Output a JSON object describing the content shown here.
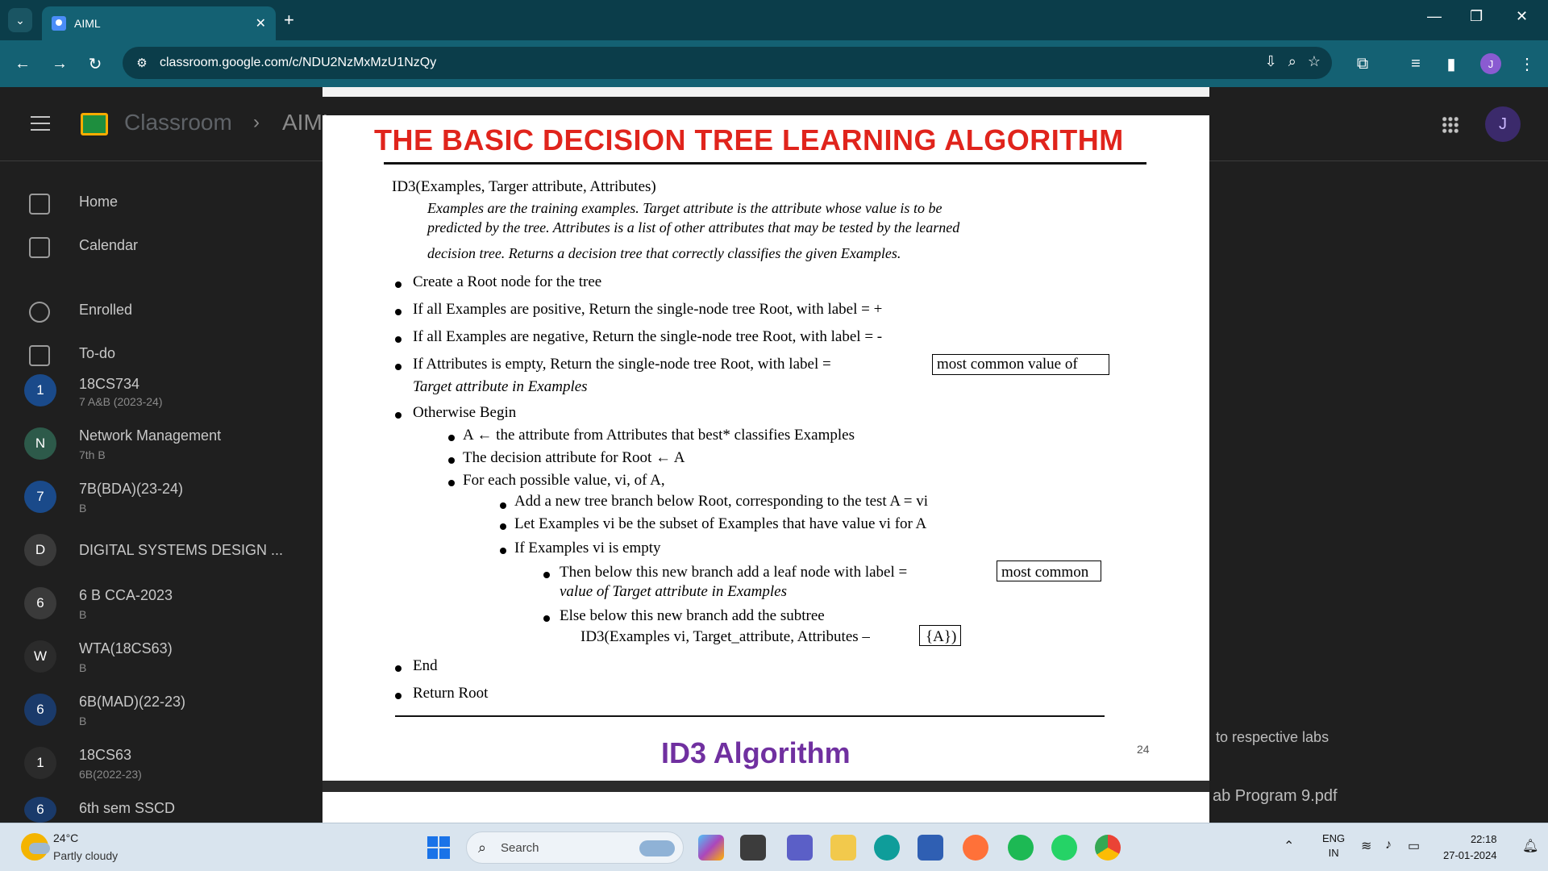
{
  "browser": {
    "tab_title": "AIML",
    "url": "classroom.google.com/c/NDU2NzMxMzU1NzQy",
    "avatar_letter": "J"
  },
  "classroom": {
    "app_name": "Classroom",
    "crumb": "AIML",
    "avatar_letter": "J",
    "nav": [
      {
        "label": "Home"
      },
      {
        "label": "Calendar"
      },
      {
        "label": "Enrolled"
      },
      {
        "label": "To-do"
      }
    ],
    "courses": [
      {
        "letter": "1",
        "name": "18CS734",
        "sub": "7 A&B (2023-24)",
        "color": "#1a4a8a"
      },
      {
        "letter": "N",
        "name": "Network Management",
        "sub": "7th B",
        "color": "#2d5a4a"
      },
      {
        "letter": "7",
        "name": "7B(BDA)(23-24)",
        "sub": "B",
        "color": "#1a4a8a"
      },
      {
        "letter": "D",
        "name": "DIGITAL SYSTEMS DESIGN ...",
        "sub": "",
        "color": "#3a3a3a"
      },
      {
        "letter": "6",
        "name": "6 B CCA-2023",
        "sub": "B",
        "color": "#3a3a3a"
      },
      {
        "letter": "W",
        "name": "WTA(18CS63)",
        "sub": "B",
        "color": "#2b2b2b"
      },
      {
        "letter": "6",
        "name": "6B(MAD)(22-23)",
        "sub": "B",
        "color": "#1a3a6a"
      },
      {
        "letter": "1",
        "name": "18CS63",
        "sub": "6B(2022-23)",
        "color": "#2b2b2b"
      },
      {
        "letter": "6",
        "name": "6th sem SSCD",
        "sub": "",
        "color": "#1a3a6a"
      }
    ],
    "right_texts": {
      "labs": "to respective labs",
      "file": "ab Program 9.pdf"
    }
  },
  "pdf": {
    "slide_title": "THE BASIC DECISION TREE LEARNING ALGORITHM",
    "caption": "ID3 Algorithm",
    "page_number": "24",
    "lines": {
      "signature": "ID3(Examples, Targer attribute, Attributes)",
      "desc1": "Examples are the training examples. Target attribute is the attribute whose value is to be",
      "desc2": "predicted by the tree. Attributes is a list of other attributes that may be tested by the learned",
      "desc3": "decision tree. Returns a decision tree that correctly classifies the given Examples.",
      "b1": "Create a Root node for the tree",
      "b2": "If all Examples are positive, Return the single-node tree Root, with label = +",
      "b3": "If all Examples are negative, Return the single-node tree Root, with label = -",
      "b4a": "If Attributes is empty, Return the single-node tree Root, with label =",
      "b4b": "most common value of",
      "b4c": "Target attribute in Examples",
      "b5": "Otherwise Begin",
      "s1": "A ← the attribute from Attributes that best* classifies Examples",
      "s2": "The decision attribute for Root ← A",
      "s3": "For each possible value, vi, of A,",
      "t1": "Add a new tree branch below Root, corresponding to the test A = vi",
      "t2": "Let Examples vi be the subset of Examples that have value vi for A",
      "t3": "If Examples vi is empty",
      "u1a": "Then below this new branch add a leaf node with label =",
      "u1b": "most common",
      "u1c": "value of Target attribute in Examples",
      "u2": "Else below this new branch add the subtree",
      "u3a": "ID3(Examples vi, Target_attribute, Attributes –",
      "u3b": "{A})",
      "end": "End",
      "ret": "Return Root"
    }
  },
  "taskbar": {
    "temp": "24°C",
    "weather": "Partly cloudy",
    "search_placeholder": "Search",
    "lang1": "ENG",
    "lang2": "IN",
    "time": "22:18",
    "date": "27-01-2024"
  }
}
